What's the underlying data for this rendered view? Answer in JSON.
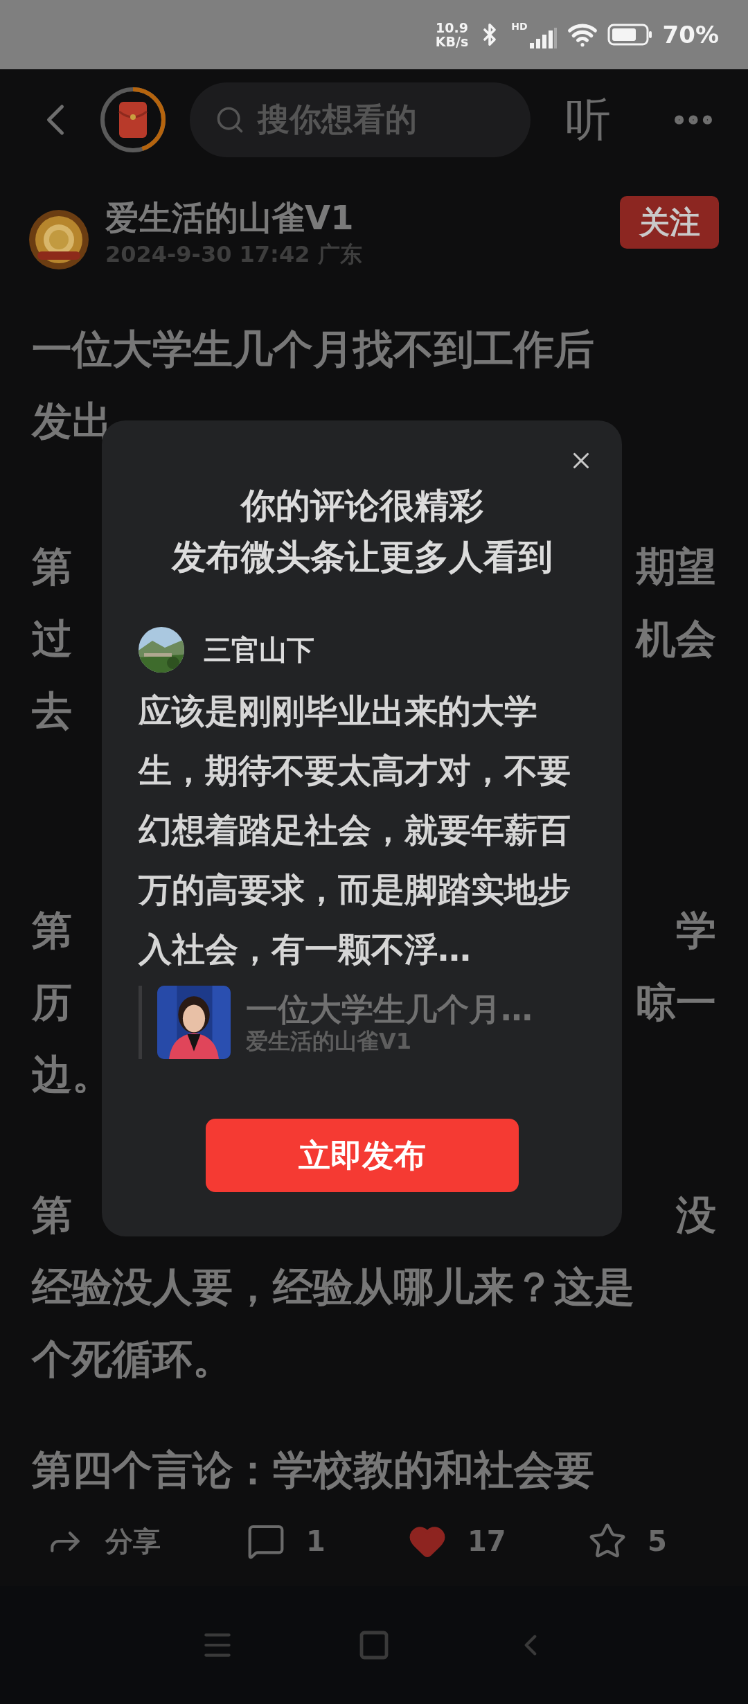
{
  "status_bar": {
    "net_speed": "10.9",
    "net_unit": "KB/s",
    "signal_label": "HD",
    "battery": "70%"
  },
  "top_bar": {
    "reward_timer": {
      "level": 0.45
    },
    "search": {
      "placeholder": "搜你想看的"
    },
    "listen": "听"
  },
  "author": {
    "name": "爱生活的山雀V1",
    "meta": "2024-9-30 17:42 广东",
    "follow": "关注",
    "following": false
  },
  "article": {
    "paragraphs": [
      {
        "lines": [
          {
            "left": "一位大学生几个月找不到工作后"
          },
          {
            "left": "发出"
          }
        ]
      },
      {
        "lines": [
          {
            "left": "第",
            "right": "期望"
          },
          {
            "left": "过",
            "right": "机会"
          },
          {
            "left": "去"
          }
        ]
      },
      {
        "lines": [
          {
            "left": "第",
            "right": "学"
          },
          {
            "left": "历",
            "right": "晾一"
          },
          {
            "left": "边。"
          }
        ]
      },
      {
        "lines": [
          {
            "left": "第",
            "right": "没"
          },
          {
            "left": "经验没人要，经验从哪儿来？这是"
          },
          {
            "left": "个死循环。"
          }
        ]
      },
      {
        "lines": [
          {
            "left": "第四个言论：学校教的和社会要"
          }
        ]
      }
    ]
  },
  "actions": [
    {
      "kind": "share",
      "label": "分享"
    },
    {
      "kind": "comment",
      "label": "1"
    },
    {
      "kind": "like",
      "label": "17",
      "selected": true
    },
    {
      "kind": "favorite",
      "label": "5",
      "selected": false
    }
  ],
  "dialog": {
    "title_lines": [
      "你的评论很精彩",
      "发布微头条让更多人看到"
    ],
    "commenter": "三官山下",
    "comment": "应该是刚刚毕业出来的大学生，期待不要太高才对，不要幻想着踏足社会，就要年薪百万的高要求，而是脚踏实地步入社会，有一颗不浮…",
    "quote": {
      "title": "一位大学生几个月…",
      "author": "爱生活的山雀V1"
    },
    "button": "立即发布"
  }
}
